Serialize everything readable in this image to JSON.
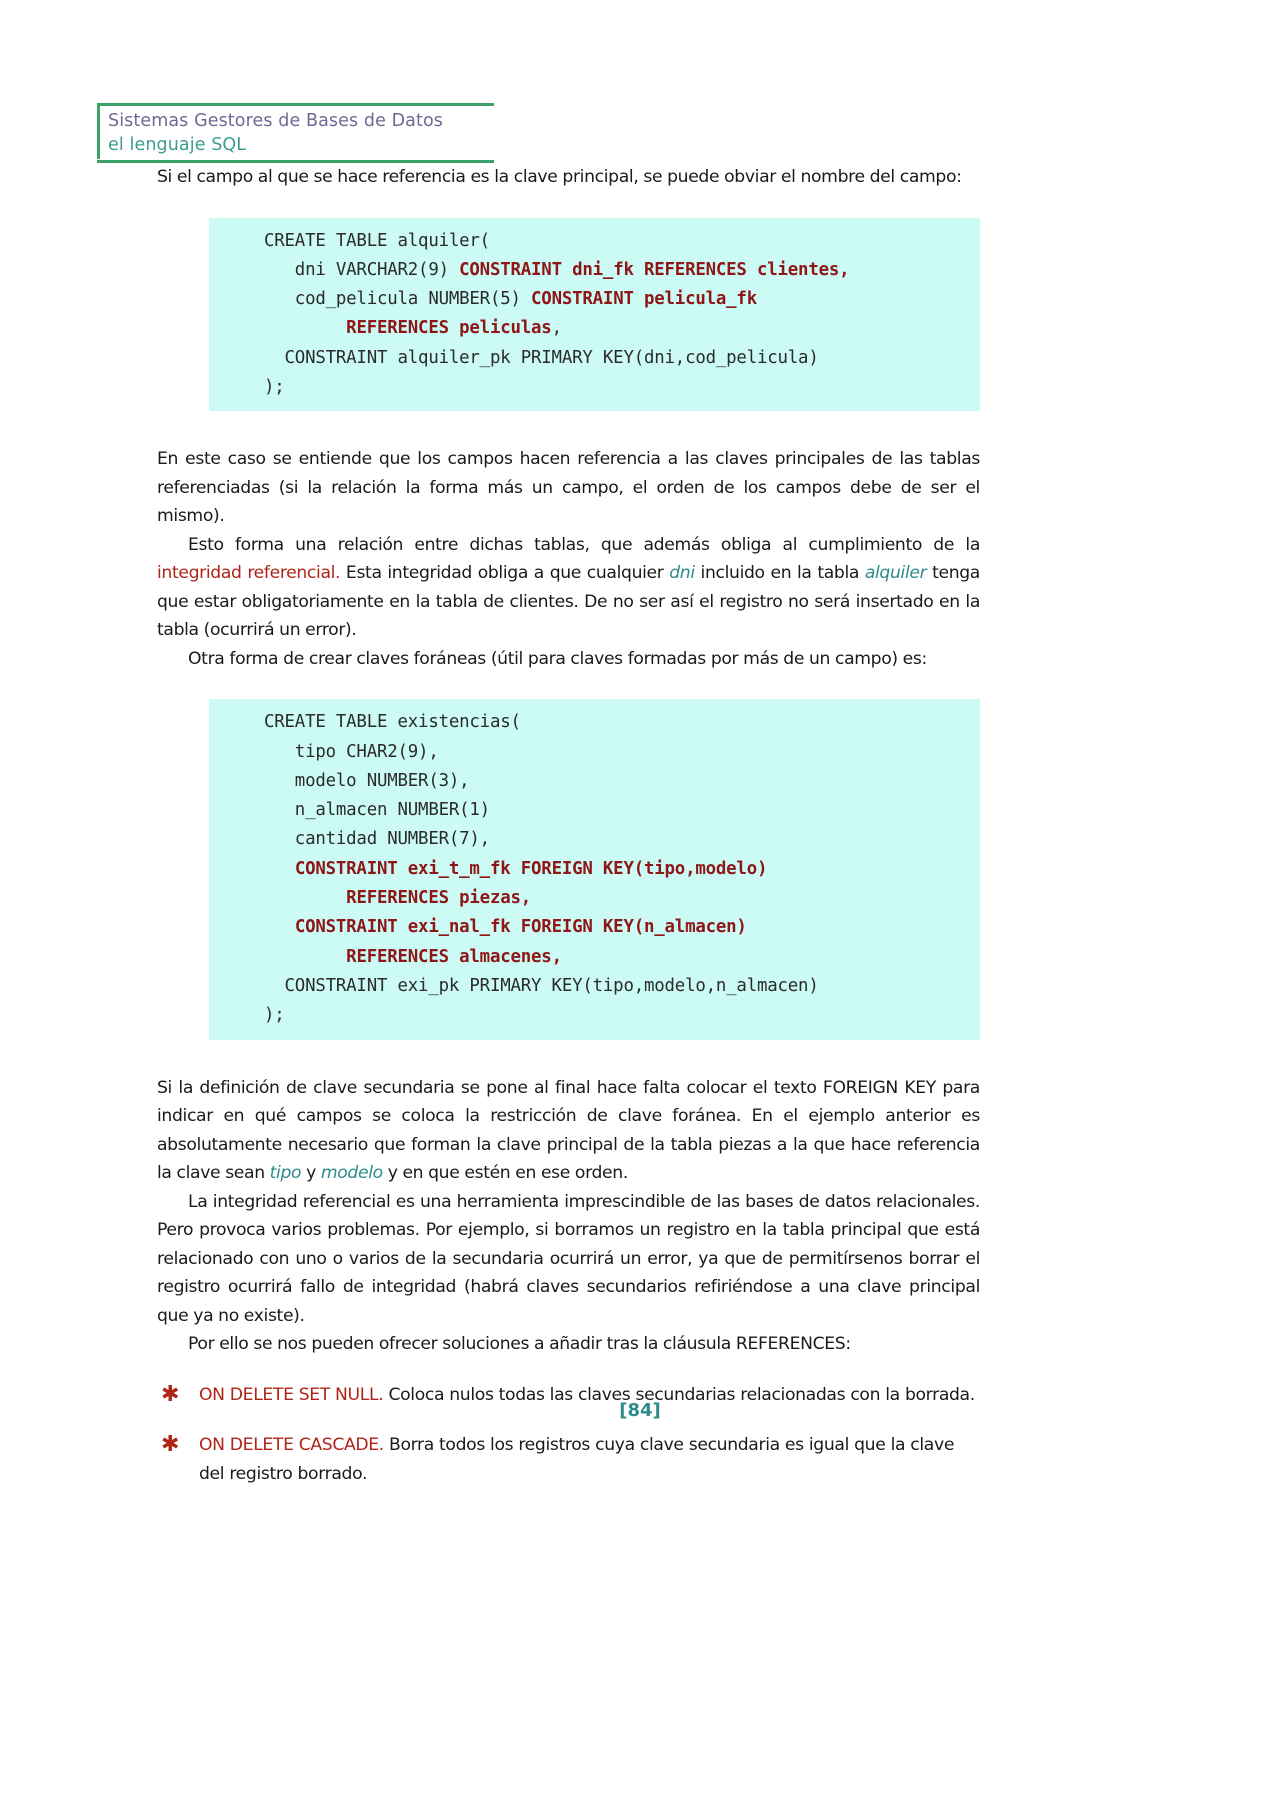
{
  "header": {
    "line1": "Sistemas Gestores de Bases de Datos",
    "line2": "el lenguaje SQL",
    "rule_color": "#3ba169",
    "line1_color": "#6b6b94",
    "line2_color": "#3f9c8e"
  },
  "colors": {
    "code_background": "#ccfbf6",
    "code_keyword": "#8f1616",
    "accent_red": "#b02418",
    "accent_teal": "#2e8b8b",
    "body_text": "#1a1a1a"
  },
  "paragraphs": {
    "p1": "Si el campo al que se hace referencia es la clave principal, se puede obviar el nombre del campo:",
    "p2": "En este caso se entiende que los campos hacen referencia a las claves principales de las tablas referenciadas (si la relación la forma más un campo, el orden de los campos debe de ser el mismo).",
    "p3_a": "Esto forma una relación entre dichas tablas, que además obliga al cumplimiento de la ",
    "p3_red": "integridad referencial.",
    "p3_b": " Esta integridad obliga a que cualquier ",
    "p3_i1": "dni",
    "p3_c": " incluido en   la tabla ",
    "p3_i2": "alquiler",
    "p3_d": " tenga que estar obligatoriamente en la tabla de clientes. De no ser así el registro no será insertado en la tabla (ocurrirá un error).",
    "p4": "Otra forma de crear claves foráneas (útil para claves formadas por más de un campo) es:",
    "p5_a": "Si la definición de clave secundaria se pone al final hace falta colocar el texto FOREIGN KEY para indicar en qué campos se coloca la restricción de clave foránea. En el ejemplo anterior es absolutamente necesario que forman la clave principal de la tabla piezas a la que hace referencia la clave sean ",
    "p5_i1": "tipo",
    "p5_b": " y ",
    "p5_i2": "modelo",
    "p5_c": " y en que estén en ese orden.",
    "p6": "La integridad referencial es una herramienta imprescindible de las bases de datos relacionales. Pero provoca varios problemas. Por ejemplo, si borramos un registro en la tabla principal que está relacionado con uno o varios de la secundaria ocurrirá un error, ya que de permitírsenos borrar el registro ocurrirá fallo de integridad (habrá claves secundarios refiriéndose a una clave principal que ya no existe).",
    "p7": "Por ello se nos pueden ofrecer soluciones a añadir tras la cláusula REFERENCES:"
  },
  "code_block_1": {
    "lines": [
      {
        "segments": [
          {
            "t": "CREATE TABLE alquiler(",
            "kw": false
          }
        ]
      },
      {
        "segments": [
          {
            "t": "   dni VARCHAR2(9) ",
            "kw": false
          },
          {
            "t": "CONSTRAINT dni_fk REFERENCES clientes,",
            "kw": true
          }
        ]
      },
      {
        "segments": [
          {
            "t": "   cod_pelicula NUMBER(5) ",
            "kw": false
          },
          {
            "t": "CONSTRAINT pelicula_fk",
            "kw": true
          }
        ]
      },
      {
        "segments": [
          {
            "t": "        ",
            "kw": false
          },
          {
            "t": "REFERENCES peliculas",
            "kw": true
          },
          {
            "t": ",",
            "kw": false
          }
        ]
      },
      {
        "segments": [
          {
            "t": "  CONSTRAINT alquiler_pk PRIMARY KEY(dni,cod_pelicula)",
            "kw": false
          }
        ]
      },
      {
        "segments": [
          {
            "t": ");",
            "kw": false
          }
        ]
      }
    ]
  },
  "code_block_2": {
    "lines": [
      {
        "segments": [
          {
            "t": "CREATE TABLE existencias(",
            "kw": false
          }
        ]
      },
      {
        "segments": [
          {
            "t": "   tipo CHAR2(9),",
            "kw": false
          }
        ]
      },
      {
        "segments": [
          {
            "t": "   modelo NUMBER(3),",
            "kw": false
          }
        ]
      },
      {
        "segments": [
          {
            "t": "   n_almacen NUMBER(1)",
            "kw": false
          }
        ]
      },
      {
        "segments": [
          {
            "t": "   cantidad NUMBER(7),",
            "kw": false
          }
        ]
      },
      {
        "segments": [
          {
            "t": "   ",
            "kw": false
          },
          {
            "t": "CONSTRAINT exi_t_m_fk FOREIGN KEY(tipo,modelo)",
            "kw": true
          }
        ]
      },
      {
        "segments": [
          {
            "t": "        ",
            "kw": false
          },
          {
            "t": "REFERENCES piezas,",
            "kw": true
          }
        ]
      },
      {
        "segments": [
          {
            "t": "   ",
            "kw": false
          },
          {
            "t": "CONSTRAINT exi_nal_fk FOREIGN KEY(n_almacen)",
            "kw": true
          }
        ]
      },
      {
        "segments": [
          {
            "t": "        ",
            "kw": false
          },
          {
            "t": "REFERENCES almacenes,",
            "kw": true
          }
        ]
      },
      {
        "segments": [
          {
            "t": "  CONSTRAINT exi_pk PRIMARY KEY(tipo,modelo,n_almacen)",
            "kw": false
          }
        ]
      },
      {
        "segments": [
          {
            "t": ");",
            "kw": false
          }
        ]
      }
    ]
  },
  "bullets": [
    {
      "marker": "✱",
      "lead": "ON DELETE SET NULL.",
      "rest": " Coloca nulos todas las claves secundarias relacionadas con la borrada."
    },
    {
      "marker": "✱",
      "lead": "ON DELETE CASCADE.",
      "rest": " Borra todos los registros cuya clave secundaria es igual que la clave del registro borrado."
    }
  ],
  "footer": {
    "page_number": "[84]"
  }
}
